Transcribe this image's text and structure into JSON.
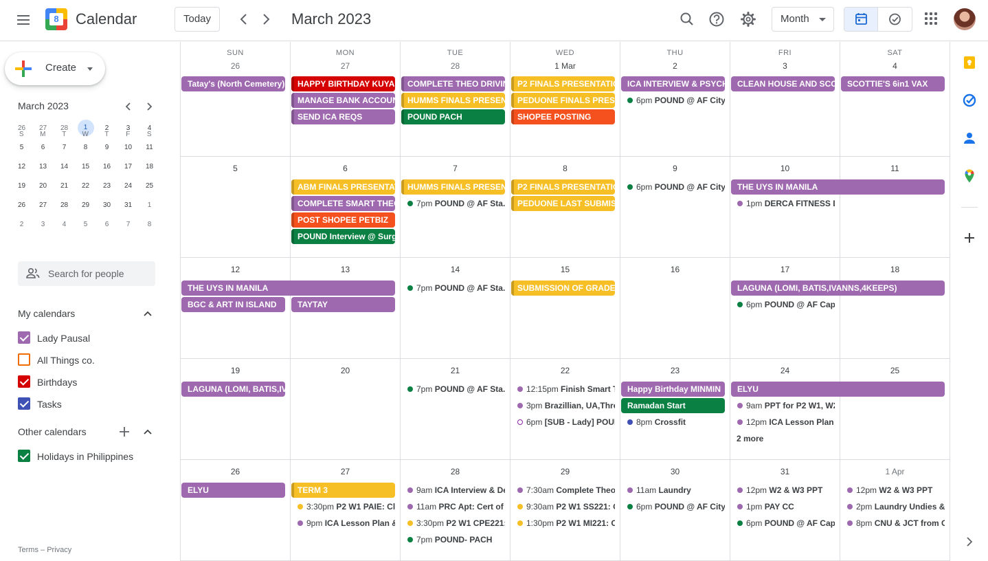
{
  "app": {
    "title": "Calendar",
    "logo_day": "8"
  },
  "header": {
    "today_label": "Today",
    "current_month": "March 2023",
    "view_label": "Month",
    "icons": [
      "menu-icon",
      "search-icon",
      "help-icon",
      "settings-icon",
      "calendar-view-icon",
      "tasks-view-icon",
      "apps-icon"
    ]
  },
  "sidebar": {
    "create_label": "Create",
    "mini_title": "March 2023",
    "mini_dow": [
      "S",
      "M",
      "T",
      "W",
      "T",
      "F",
      "S"
    ],
    "mini_weeks": [
      [
        "26",
        "27",
        "28",
        "1",
        "2",
        "3",
        "4"
      ],
      [
        "5",
        "6",
        "7",
        "8",
        "9",
        "10",
        "11"
      ],
      [
        "12",
        "13",
        "14",
        "15",
        "16",
        "17",
        "18"
      ],
      [
        "19",
        "20",
        "21",
        "22",
        "23",
        "24",
        "25"
      ],
      [
        "26",
        "27",
        "28",
        "29",
        "30",
        "31",
        "1"
      ],
      [
        "2",
        "3",
        "4",
        "5",
        "6",
        "7",
        "8"
      ]
    ],
    "search_placeholder": "Search for people",
    "my_calendars_title": "My calendars",
    "my_calendars": [
      {
        "label": "Lady Pausal",
        "color": "#9e69af",
        "checked": true
      },
      {
        "label": "All Things co.",
        "color": "#ef6c00",
        "checked": false
      },
      {
        "label": "Birthdays",
        "color": "#d50000",
        "checked": true
      },
      {
        "label": "Tasks",
        "color": "#3f51b5",
        "checked": true
      }
    ],
    "other_calendars_title": "Other calendars",
    "other_calendars": [
      {
        "label": "Holidays in Philippines",
        "color": "#0b8043",
        "checked": true
      }
    ],
    "footer_terms": "Terms",
    "footer_sep": "–",
    "footer_privacy": "Privacy"
  },
  "grid": {
    "days_of_week": [
      "SUN",
      "MON",
      "TUE",
      "WED",
      "THU",
      "FRI",
      "SAT"
    ],
    "weeks": [
      [
        "26",
        "27",
        "28",
        "1 Mar",
        "2",
        "3",
        "4"
      ],
      [
        "5",
        "6",
        "7",
        "8",
        "9",
        "10",
        "11"
      ],
      [
        "12",
        "13",
        "14",
        "15",
        "16",
        "17",
        "18"
      ],
      [
        "19",
        "20",
        "21",
        "22",
        "23",
        "24",
        "25"
      ],
      [
        "26",
        "27",
        "28",
        "29",
        "30",
        "31",
        "1 Apr"
      ]
    ],
    "events": [
      {
        "week": 0,
        "col": 0,
        "span": 1,
        "row": 0,
        "title": "Tatay's (North Cemetery)",
        "color": "#9e69af",
        "bar": false
      },
      {
        "week": 0,
        "col": 1,
        "span": 1,
        "row": 0,
        "title": "HAPPY BIRTHDAY KUYA",
        "color": "#d50000",
        "bar": true
      },
      {
        "week": 0,
        "col": 1,
        "span": 1,
        "row": 1,
        "title": "MANAGE BANK ACCOUNT",
        "color": "#9e69af",
        "bar": true
      },
      {
        "week": 0,
        "col": 1,
        "span": 1,
        "row": 2,
        "title": "SEND ICA REQS",
        "color": "#9e69af",
        "bar": true
      },
      {
        "week": 0,
        "col": 2,
        "span": 1,
        "row": 0,
        "title": "COMPLETE THEO DRIVING",
        "color": "#9e69af",
        "bar": true
      },
      {
        "week": 0,
        "col": 2,
        "span": 1,
        "row": 1,
        "title": "HUMMS FINALS PRESENTATION",
        "color": "#f6bf26",
        "bar": true
      },
      {
        "week": 0,
        "col": 2,
        "span": 1,
        "row": 2,
        "title": "POUND PACH",
        "color": "#0b8043",
        "bar": true
      },
      {
        "week": 0,
        "col": 3,
        "span": 1,
        "row": 0,
        "title": "P2 FINALS PRESENTATION",
        "color": "#f6bf26",
        "bar": true
      },
      {
        "week": 0,
        "col": 3,
        "span": 1,
        "row": 1,
        "title": "PEDUONE FINALS PRESENTATION",
        "color": "#f6bf26",
        "bar": true
      },
      {
        "week": 0,
        "col": 3,
        "span": 1,
        "row": 2,
        "title": "SHOPEE POSTING",
        "color": "#f4511e",
        "bar": true
      },
      {
        "week": 0,
        "col": 4,
        "span": 1,
        "row": 0,
        "title": "ICA INTERVIEW & PSYCH",
        "color": "#9e69af",
        "bar": false
      },
      {
        "week": 0,
        "col": 5,
        "span": 1,
        "row": 0,
        "title": "CLEAN HOUSE AND SCOOP",
        "color": "#9e69af",
        "bar": false
      },
      {
        "week": 0,
        "col": 6,
        "span": 1,
        "row": 0,
        "title": "SCOTTIE'S 6in1 VAX",
        "color": "#9e69af",
        "bar": false
      },
      {
        "week": 1,
        "col": 1,
        "span": 1,
        "row": 0,
        "title": "ABM FINALS PRESENTATION",
        "color": "#f6bf26",
        "bar": true
      },
      {
        "week": 1,
        "col": 1,
        "span": 1,
        "row": 1,
        "title": "COMPLETE SMART THEO",
        "color": "#9e69af",
        "bar": true
      },
      {
        "week": 1,
        "col": 1,
        "span": 1,
        "row": 2,
        "title": "POST SHOPEE PETBIZ",
        "color": "#f4511e",
        "bar": true
      },
      {
        "week": 1,
        "col": 1,
        "span": 1,
        "row": 3,
        "title": "POUND Interview @ Surge",
        "color": "#0b8043",
        "bar": true
      },
      {
        "week": 1,
        "col": 2,
        "span": 1,
        "row": 0,
        "title": "HUMMS FINALS PRESENTATION",
        "color": "#f6bf26",
        "bar": true
      },
      {
        "week": 1,
        "col": 3,
        "span": 1,
        "row": 0,
        "title": "P2 FINALS PRESENTATION",
        "color": "#f6bf26",
        "bar": true
      },
      {
        "week": 1,
        "col": 3,
        "span": 1,
        "row": 1,
        "title": "PEDUONE LAST SUBMISSION",
        "color": "#f6bf26",
        "bar": true
      },
      {
        "week": 1,
        "col": 5,
        "span": 2,
        "row": 0,
        "title": "THE UYS IN MANILA",
        "color": "#9e69af",
        "bar": false
      },
      {
        "week": 2,
        "col": 0,
        "span": 2,
        "row": 0,
        "title": "THE UYS IN MANILA",
        "color": "#9e69af",
        "bar": false
      },
      {
        "week": 2,
        "col": 0,
        "span": 1,
        "row": 1,
        "title": "BGC & ART IN ISLAND",
        "color": "#9e69af",
        "bar": false
      },
      {
        "week": 2,
        "col": 1,
        "span": 1,
        "row": 1,
        "title": "TAYTAY",
        "color": "#9e69af",
        "bar": false
      },
      {
        "week": 2,
        "col": 3,
        "span": 1,
        "row": 0,
        "title": "SUBMISSION OF GRADES",
        "color": "#f6bf26",
        "bar": true
      },
      {
        "week": 2,
        "col": 5,
        "span": 2,
        "row": 0,
        "title": "LAGUNA (LOMI, BATIS,IVANNS,4KEEPS)",
        "color": "#9e69af",
        "bar": false
      },
      {
        "week": 3,
        "col": 0,
        "span": 1,
        "row": 0,
        "title": "LAGUNA (LOMI, BATIS,IVANNS,4KEEPS)",
        "color": "#9e69af",
        "bar": false
      },
      {
        "week": 3,
        "col": 4,
        "span": 1,
        "row": 0,
        "title": "Happy Birthday MINMIN",
        "color": "#9e69af",
        "bar": false
      },
      {
        "week": 3,
        "col": 4,
        "span": 1,
        "row": 1,
        "title": "Ramadan Start",
        "color": "#0b8043",
        "bar": false
      },
      {
        "week": 3,
        "col": 5,
        "span": 2,
        "row": 0,
        "title": "ELYU",
        "color": "#9e69af",
        "bar": false
      },
      {
        "week": 4,
        "col": 0,
        "span": 1,
        "row": 0,
        "title": "ELYU",
        "color": "#9e69af",
        "bar": false
      },
      {
        "week": 4,
        "col": 1,
        "span": 1,
        "row": 0,
        "title": "TERM 3",
        "color": "#f6bf26",
        "bar": true
      }
    ],
    "timed_events": [
      {
        "week": 0,
        "col": 4,
        "row": 1,
        "time": "6pm",
        "title": "POUND @ AF Citygate",
        "color": "#0b8043"
      },
      {
        "week": 1,
        "col": 2,
        "row": 1,
        "time": "7pm",
        "title": "POUND @ AF Sta. Lucia",
        "color": "#0b8043"
      },
      {
        "week": 1,
        "col": 4,
        "row": 0,
        "time": "6pm",
        "title": "POUND @ AF Citygate",
        "color": "#0b8043"
      },
      {
        "week": 1,
        "col": 5,
        "row": 1,
        "time": "1pm",
        "title": "DERCA FITNESS Demo",
        "color": "#9e69af"
      },
      {
        "week": 2,
        "col": 2,
        "row": 0,
        "time": "7pm",
        "title": "POUND @ AF Sta. Lucia",
        "color": "#0b8043"
      },
      {
        "week": 2,
        "col": 5,
        "row": 1,
        "time": "6pm",
        "title": "POUND @ AF Capitol",
        "color": "#0b8043"
      },
      {
        "week": 3,
        "col": 2,
        "row": 0,
        "time": "7pm",
        "title": "POUND @ AF Sta.Mesa",
        "color": "#0b8043"
      },
      {
        "week": 3,
        "col": 3,
        "row": 0,
        "time": "12:15pm",
        "title": "Finish Smart Theo",
        "color": "#9e69af"
      },
      {
        "week": 3,
        "col": 3,
        "row": 1,
        "time": "3pm",
        "title": "Brazillian, UA,Threading",
        "color": "#9e69af"
      },
      {
        "week": 3,
        "col": 3,
        "row": 2,
        "time": "6pm",
        "title": "[SUB - Lady] POUND",
        "color": "#9e69af",
        "ring": true
      },
      {
        "week": 3,
        "col": 4,
        "row": 2,
        "time": "8pm",
        "title": "Crossfit",
        "color": "#3f51b5"
      },
      {
        "week": 3,
        "col": 5,
        "row": 1,
        "time": "9am",
        "title": "PPT for P2 W1, W2",
        "color": "#9e69af"
      },
      {
        "week": 3,
        "col": 5,
        "row": 2,
        "time": "12pm",
        "title": "ICA Lesson Plan &",
        "color": "#9e69af"
      },
      {
        "week": 4,
        "col": 1,
        "row": 1,
        "time": "3:30pm",
        "title": "P2 W1 PAIE: Class",
        "color": "#f6bf26"
      },
      {
        "week": 4,
        "col": 1,
        "row": 2,
        "time": "9pm",
        "title": "ICA Lesson Plan &",
        "color": "#9e69af"
      },
      {
        "week": 4,
        "col": 2,
        "row": 0,
        "time": "9am",
        "title": "ICA Interview & Demo",
        "color": "#9e69af"
      },
      {
        "week": 4,
        "col": 2,
        "row": 1,
        "time": "11am",
        "title": "PRC Apt: Cert of Regis",
        "color": "#9e69af"
      },
      {
        "week": 4,
        "col": 2,
        "row": 2,
        "time": "3:30pm",
        "title": "P2 W1 CPE221:",
        "color": "#f6bf26"
      },
      {
        "week": 4,
        "col": 2,
        "row": 3,
        "time": "7pm",
        "title": "POUND- PACH",
        "color": "#0b8043"
      },
      {
        "week": 4,
        "col": 3,
        "row": 0,
        "time": "7:30am",
        "title": "Complete Theo",
        "color": "#9e69af"
      },
      {
        "week": 4,
        "col": 3,
        "row": 1,
        "time": "9:30am",
        "title": "P2 W1 SS221: C",
        "color": "#f6bf26"
      },
      {
        "week": 4,
        "col": 3,
        "row": 2,
        "time": "1:30pm",
        "title": "P2 W1 MI221: C",
        "color": "#f6bf26"
      },
      {
        "week": 4,
        "col": 4,
        "row": 0,
        "time": "11am",
        "title": "Laundry",
        "color": "#9e69af"
      },
      {
        "week": 4,
        "col": 4,
        "row": 1,
        "time": "6pm",
        "title": "POUND @ AF Citygate",
        "color": "#0b8043"
      },
      {
        "week": 4,
        "col": 5,
        "row": 0,
        "time": "12pm",
        "title": "W2 & W3 PPT",
        "color": "#9e69af"
      },
      {
        "week": 4,
        "col": 5,
        "row": 1,
        "time": "1pm",
        "title": "PAY CC",
        "color": "#9e69af"
      },
      {
        "week": 4,
        "col": 5,
        "row": 2,
        "time": "6pm",
        "title": "POUND @ AF Capitol",
        "color": "#0b8043"
      },
      {
        "week": 4,
        "col": 6,
        "row": 0,
        "time": "12pm",
        "title": "W2 & W3 PPT",
        "color": "#9e69af"
      },
      {
        "week": 4,
        "col": 6,
        "row": 1,
        "time": "2pm",
        "title": "Laundry Undies & Work",
        "color": "#9e69af"
      },
      {
        "week": 4,
        "col": 6,
        "row": 2,
        "time": "8pm",
        "title": "CNU & JCT from CDO",
        "color": "#9e69af"
      }
    ],
    "more": [
      {
        "week": 3,
        "col": 5,
        "row": 3,
        "label": "2 more"
      }
    ]
  },
  "rail": {
    "icons": [
      "keep-icon",
      "tasks-icon",
      "contacts-icon",
      "maps-icon",
      "add-addon-icon",
      "expand-panel-icon"
    ]
  }
}
